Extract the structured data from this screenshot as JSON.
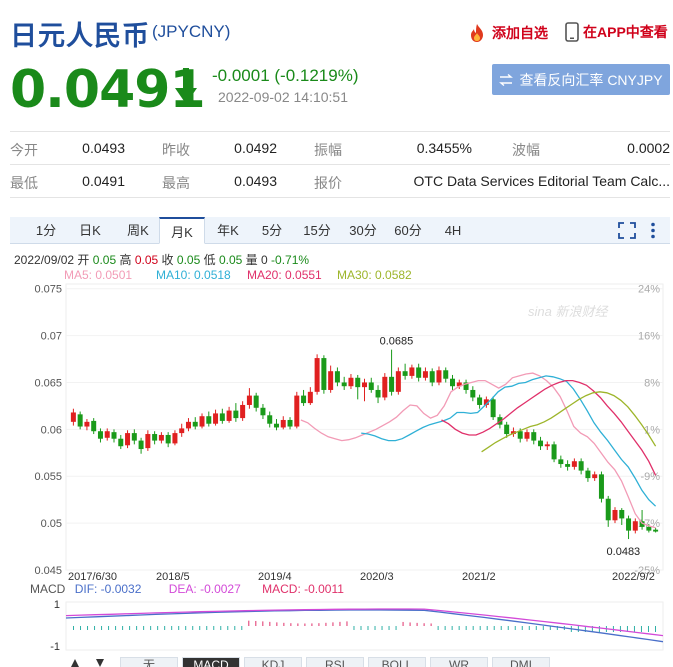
{
  "header": {
    "title": "日元人民币",
    "code": "(JPYCNY)",
    "add_watch": "添加自选",
    "app_view": "在APP中查看"
  },
  "quote": {
    "price": "0.0491",
    "change": "-0.0001 (-0.1219%)",
    "timestamp": "2022-09-02 14:10:51",
    "reverse_button": "查看反向汇率 CNYJPY"
  },
  "stats": [
    {
      "label": "今开",
      "value": "0.0493"
    },
    {
      "label": "昨收",
      "value": "0.0492"
    },
    {
      "label": "振幅",
      "value": "0.3455%"
    },
    {
      "label": "波幅",
      "value": "0.0002"
    },
    {
      "label": "最低",
      "value": "0.0491"
    },
    {
      "label": "最高",
      "value": "0.0493"
    },
    {
      "label": "报价",
      "value": "OTC Data Services Editorial Team Calc..."
    }
  ],
  "tabs": [
    {
      "label": "1分"
    },
    {
      "label": "日K"
    },
    {
      "label": "周K"
    },
    {
      "label": "月K"
    },
    {
      "label": "年K"
    },
    {
      "label": "5分"
    },
    {
      "label": "15分"
    },
    {
      "label": "30分"
    },
    {
      "label": "60分"
    },
    {
      "label": "4H"
    }
  ],
  "active_tab": "月K",
  "ohlc_line": {
    "date": "2022/09/02",
    "open_label": "开",
    "open": "0.05",
    "high_label": "高",
    "high": "0.05",
    "close_label": "收",
    "close": "0.05",
    "low_label": "低",
    "low": "0.05",
    "vol_label": "量",
    "vol": "0",
    "pct": "-0.71%"
  },
  "ma_line": [
    {
      "text": "MA5: 0.0501",
      "color": "#f29bb6"
    },
    {
      "text": "MA10: 0.0518",
      "color": "#2fb0d6"
    },
    {
      "text": "MA20: 0.0551",
      "color": "#e0306a"
    },
    {
      "text": "MA30: 0.0582",
      "color": "#9db52a"
    }
  ],
  "watermark": "sina 新浪财经",
  "chart_data": {
    "type": "candlestick",
    "y_ticks": [
      "0.075",
      "0.07",
      "0.065",
      "0.06",
      "0.055",
      "0.05",
      "0.045"
    ],
    "y_tick_values": [
      0.075,
      0.07,
      0.065,
      0.06,
      0.055,
      0.05,
      0.045
    ],
    "pct_ticks": [
      "24%",
      "16%",
      "8%",
      "1%",
      "-9%",
      "-17%",
      "-25%"
    ],
    "x_ticks": [
      "2017/6/30",
      "2018/5",
      "2019/4",
      "2020/3",
      "2021/2",
      "2022/9/2"
    ],
    "ylim": [
      0.045,
      0.0755
    ],
    "annotations": [
      {
        "text": "0.0685",
        "value": 0.0685
      },
      {
        "text": "0.0483",
        "value": 0.0483
      }
    ],
    "candles": [
      [
        0.0608,
        0.0618,
        0.0622,
        0.0604
      ],
      [
        0.0616,
        0.0603,
        0.0619,
        0.06
      ],
      [
        0.0603,
        0.0608,
        0.0611,
        0.0599
      ],
      [
        0.0609,
        0.0598,
        0.0612,
        0.0595
      ],
      [
        0.0598,
        0.059,
        0.0601,
        0.0586
      ],
      [
        0.0591,
        0.0598,
        0.0601,
        0.0588
      ],
      [
        0.0597,
        0.059,
        0.06,
        0.0586
      ],
      [
        0.059,
        0.0582,
        0.0594,
        0.0579
      ],
      [
        0.0583,
        0.0596,
        0.0599,
        0.058
      ],
      [
        0.0596,
        0.0588,
        0.06,
        0.0584
      ],
      [
        0.0588,
        0.0579,
        0.0591,
        0.0574
      ],
      [
        0.058,
        0.0595,
        0.0599,
        0.0577
      ],
      [
        0.0595,
        0.0588,
        0.0598,
        0.0584
      ],
      [
        0.0588,
        0.0594,
        0.0597,
        0.0585
      ],
      [
        0.0594,
        0.0585,
        0.0597,
        0.0581
      ],
      [
        0.0585,
        0.0596,
        0.0599,
        0.0583
      ],
      [
        0.0596,
        0.0601,
        0.0606,
        0.0592
      ],
      [
        0.0601,
        0.0608,
        0.0612,
        0.0598
      ],
      [
        0.0608,
        0.0603,
        0.0613,
        0.06
      ],
      [
        0.0603,
        0.0614,
        0.0617,
        0.0601
      ],
      [
        0.0614,
        0.0606,
        0.0619,
        0.0603
      ],
      [
        0.0606,
        0.0617,
        0.0621,
        0.0604
      ],
      [
        0.0617,
        0.0609,
        0.0622,
        0.0606
      ],
      [
        0.0609,
        0.062,
        0.0624,
        0.0607
      ],
      [
        0.062,
        0.0612,
        0.0628,
        0.0608
      ],
      [
        0.0612,
        0.0626,
        0.063,
        0.0609
      ],
      [
        0.0626,
        0.0636,
        0.0644,
        0.0622
      ],
      [
        0.0636,
        0.0623,
        0.0639,
        0.0619
      ],
      [
        0.0623,
        0.0615,
        0.0627,
        0.0611
      ],
      [
        0.0615,
        0.0606,
        0.0619,
        0.0602
      ],
      [
        0.0606,
        0.0602,
        0.0611,
        0.0599
      ],
      [
        0.0602,
        0.061,
        0.0614,
        0.06
      ],
      [
        0.061,
        0.0603,
        0.0613,
        0.06
      ],
      [
        0.0603,
        0.0636,
        0.064,
        0.0601
      ],
      [
        0.0636,
        0.0628,
        0.0642,
        0.0625
      ],
      [
        0.0628,
        0.064,
        0.0645,
        0.0626
      ],
      [
        0.064,
        0.0676,
        0.068,
        0.0637
      ],
      [
        0.0676,
        0.0642,
        0.0679,
        0.0638
      ],
      [
        0.0642,
        0.0662,
        0.0668,
        0.0639
      ],
      [
        0.0662,
        0.065,
        0.0666,
        0.0646
      ],
      [
        0.065,
        0.0646,
        0.0656,
        0.0642
      ],
      [
        0.0646,
        0.0655,
        0.0659,
        0.0643
      ],
      [
        0.0655,
        0.0645,
        0.0658,
        0.0632
      ],
      [
        0.0645,
        0.065,
        0.0654,
        0.063
      ],
      [
        0.065,
        0.0642,
        0.0655,
        0.0639
      ],
      [
        0.0642,
        0.0634,
        0.0647,
        0.0628
      ],
      [
        0.0634,
        0.0656,
        0.066,
        0.0631
      ],
      [
        0.0656,
        0.064,
        0.0685,
        0.0636
      ],
      [
        0.064,
        0.0662,
        0.0666,
        0.0637
      ],
      [
        0.0662,
        0.0657,
        0.067,
        0.0653
      ],
      [
        0.0657,
        0.0666,
        0.0669,
        0.0654
      ],
      [
        0.0666,
        0.0655,
        0.067,
        0.0651
      ],
      [
        0.0655,
        0.0662,
        0.0666,
        0.0652
      ],
      [
        0.0662,
        0.065,
        0.0665,
        0.0646
      ],
      [
        0.065,
        0.0663,
        0.0667,
        0.0647
      ],
      [
        0.0663,
        0.0654,
        0.0666,
        0.065
      ],
      [
        0.0654,
        0.0646,
        0.0658,
        0.0642
      ],
      [
        0.0646,
        0.065,
        0.0653,
        0.0643
      ],
      [
        0.065,
        0.0642,
        0.0653,
        0.0638
      ],
      [
        0.0642,
        0.0634,
        0.0646,
        0.063
      ],
      [
        0.0634,
        0.0626,
        0.0637,
        0.0622
      ],
      [
        0.0626,
        0.0632,
        0.0635,
        0.0623
      ],
      [
        0.0632,
        0.0613,
        0.0635,
        0.061
      ],
      [
        0.0613,
        0.0605,
        0.0616,
        0.0601
      ],
      [
        0.0605,
        0.0595,
        0.0608,
        0.0591
      ],
      [
        0.0595,
        0.0598,
        0.0602,
        0.0592
      ],
      [
        0.0598,
        0.059,
        0.0601,
        0.0586
      ],
      [
        0.059,
        0.0597,
        0.06,
        0.0587
      ],
      [
        0.0597,
        0.0588,
        0.06,
        0.0584
      ],
      [
        0.0588,
        0.0582,
        0.0592,
        0.0578
      ],
      [
        0.0582,
        0.0584,
        0.0587,
        0.0578
      ],
      [
        0.0584,
        0.0568,
        0.0587,
        0.0565
      ],
      [
        0.0568,
        0.0563,
        0.0572,
        0.0559
      ],
      [
        0.0563,
        0.056,
        0.0567,
        0.0556
      ],
      [
        0.056,
        0.0566,
        0.0569,
        0.0557
      ],
      [
        0.0566,
        0.0556,
        0.0569,
        0.0552
      ],
      [
        0.0556,
        0.0548,
        0.0559,
        0.0544
      ],
      [
        0.0548,
        0.0552,
        0.0555,
        0.0545
      ],
      [
        0.0552,
        0.0526,
        0.0555,
        0.0522
      ],
      [
        0.0526,
        0.0503,
        0.0529,
        0.0496
      ],
      [
        0.0503,
        0.0514,
        0.0517,
        0.05
      ],
      [
        0.0514,
        0.0505,
        0.0516,
        0.0498
      ],
      [
        0.0505,
        0.0492,
        0.0508,
        0.0483
      ],
      [
        0.0492,
        0.0502,
        0.0505,
        0.0489
      ],
      [
        0.0502,
        0.0496,
        0.0514,
        0.0493
      ],
      [
        0.0496,
        0.0492,
        0.0499,
        0.049
      ],
      [
        0.0493,
        0.0491,
        0.0495,
        0.049
      ]
    ],
    "ma_series": [
      {
        "name": "MA5",
        "color": "#f29bb6",
        "values": [
          0.061,
          0.0607,
          0.0601,
          0.0596,
          0.0592,
          0.059,
          0.0588,
          0.0589,
          0.0591,
          0.0594,
          0.0597,
          0.06,
          0.0604,
          0.0608,
          0.0613,
          0.062,
          0.0626,
          0.0625,
          0.0617,
          0.0612,
          0.0615,
          0.0625,
          0.064,
          0.0645,
          0.0648,
          0.065,
          0.0652,
          0.0652,
          0.0648,
          0.0644,
          0.0648,
          0.0655,
          0.0657,
          0.0659,
          0.066,
          0.0657,
          0.0652,
          0.0645,
          0.0635,
          0.062,
          0.0603,
          0.0596,
          0.0592,
          0.0585,
          0.0575,
          0.0565,
          0.0557,
          0.0545,
          0.0528,
          0.051,
          0.05,
          0.0497,
          0.0495
        ]
      },
      {
        "name": "MA10",
        "color": "#2fb0d6",
        "values": [
          0.0596,
          0.0595,
          0.0593,
          0.059,
          0.0588,
          0.0588,
          0.059,
          0.0594,
          0.0598,
          0.0602,
          0.0605,
          0.0607,
          0.0609,
          0.0612,
          0.0618,
          0.0618,
          0.0617,
          0.0618,
          0.0625,
          0.0632,
          0.064,
          0.0645,
          0.0646,
          0.0649,
          0.065,
          0.0653,
          0.0655,
          0.0657,
          0.0656,
          0.0654,
          0.0651,
          0.0643,
          0.0632,
          0.062,
          0.0607,
          0.0597,
          0.0588,
          0.0578,
          0.0568,
          0.056,
          0.0548,
          0.0535,
          0.0525,
          0.0518
        ]
      },
      {
        "name": "MA20",
        "color": "#e0306a",
        "values": [
          0.061,
          0.0606,
          0.06,
          0.0596,
          0.0594,
          0.0594,
          0.0597,
          0.0601,
          0.0606,
          0.0611,
          0.0617,
          0.0623,
          0.0628,
          0.0633,
          0.0638,
          0.0643,
          0.0647,
          0.065,
          0.0652,
          0.0652,
          0.065,
          0.0647,
          0.0641,
          0.0634,
          0.0625,
          0.0617,
          0.0608,
          0.0598,
          0.0588,
          0.0578,
          0.0566,
          0.0551
        ]
      },
      {
        "name": "MA30",
        "color": "#9db52a",
        "values": [
          0.0576,
          0.0581,
          0.0586,
          0.059,
          0.0594,
          0.0597,
          0.06,
          0.0603,
          0.0605,
          0.0608,
          0.0612,
          0.0617,
          0.0622,
          0.0627,
          0.0632,
          0.0636,
          0.0639,
          0.064,
          0.0639,
          0.0636,
          0.0631,
          0.0624,
          0.0615,
          0.0605,
          0.0594,
          0.0582
        ]
      }
    ]
  },
  "macd": {
    "label": "MACD",
    "dif": "DIF: -0.0032",
    "dea": "DEA: -0.0027",
    "macd": "MACD: -0.0011",
    "dif_color": "#4a6fc9",
    "dea_color": "#d34ad8",
    "macd_color": "#e0306a",
    "y_top": "1",
    "y_bottom": "-1"
  },
  "bottom_tabs": [
    {
      "label": "无"
    },
    {
      "label": "MACD"
    },
    {
      "label": "KDJ"
    },
    {
      "label": "RSI"
    },
    {
      "label": "BOLL"
    },
    {
      "label": "WR"
    },
    {
      "label": "DMI"
    }
  ],
  "active_bottom_tab": "MACD"
}
